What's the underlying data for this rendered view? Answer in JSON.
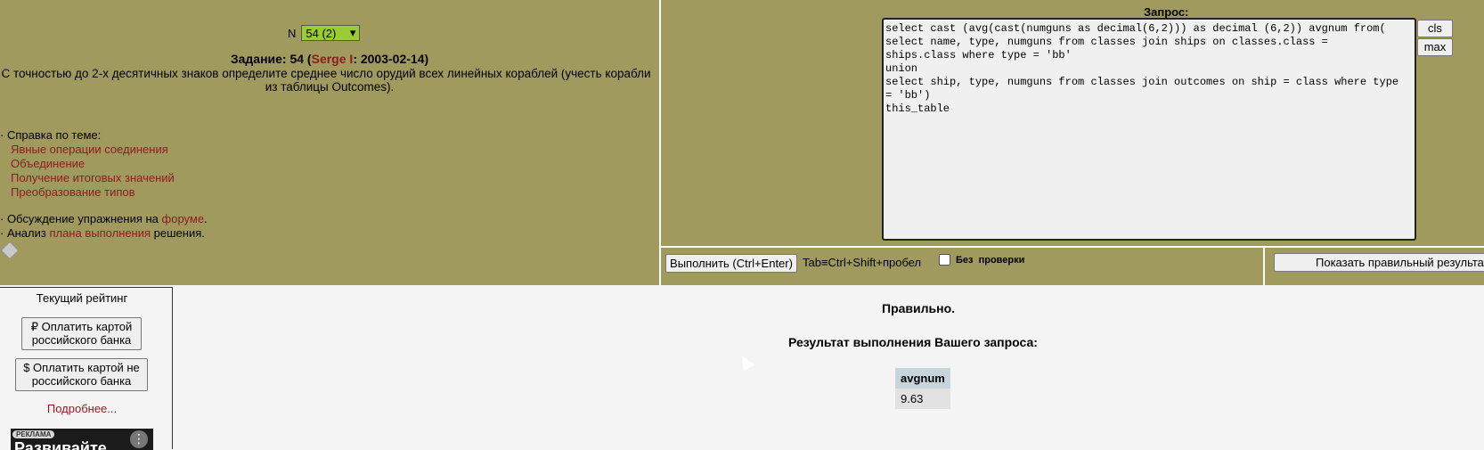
{
  "task": {
    "n_label": "N",
    "n_selected": "54 (2)",
    "title_prefix": "Задание: 54 (",
    "author": "Serge I",
    "title_suffix": ": 2003-02-14)",
    "text_line1": "С точностью до 2-х десятичных знаков определите среднее число орудий всех линейных кораблей (учесть корабли",
    "text_line2": "из таблицы Outcomes)."
  },
  "help": {
    "heading": "· Справка по теме:",
    "links": [
      "Явные операции соединения",
      "Объединение",
      "Получение итоговых значений",
      "Преобразование типов"
    ]
  },
  "discussion": {
    "line1_prefix": "· Обсуждение упражнения на ",
    "line1_link": "форуме",
    "line1_suffix": ".",
    "line2_prefix": "· Анализ ",
    "line2_link": "плана выполнения",
    "line2_suffix": " решения."
  },
  "query": {
    "label": "Запрос:",
    "text": "select cast (avg(cast(numguns as decimal(6,2))) as decimal (6,2)) avgnum from(\nselect name, type, numguns from classes join ships on classes.class =\nships.class where type = 'bb'\nunion\nselect ship, type, numguns from classes join outcomes on ship = class where type\n= 'bb')\nthis_table",
    "cls_button": "cls",
    "max_button": "max"
  },
  "toolbar": {
    "run_button": "Выполнить (Ctrl+Enter)",
    "tab_hint": "Tab≡Ctrl+Shift+пробел",
    "no_check_label": "Без  проверки",
    "show_correct_button": "Показать правильный результат"
  },
  "rating": {
    "title": "Текущий рейтинг",
    "pay_ru": "₽ Оплатить картой российского банка",
    "pay_other": "$ Оплатить картой не российского банка",
    "more_link": "Подробнее...",
    "ad_tag": "РЕКЛАМА",
    "ad_text": "Развивайте"
  },
  "result": {
    "status": "Правильно.",
    "title": "Результат выполнения Вашего запроса:",
    "columns": [
      "avgnum"
    ],
    "rows": [
      [
        "9.63"
      ]
    ]
  }
}
